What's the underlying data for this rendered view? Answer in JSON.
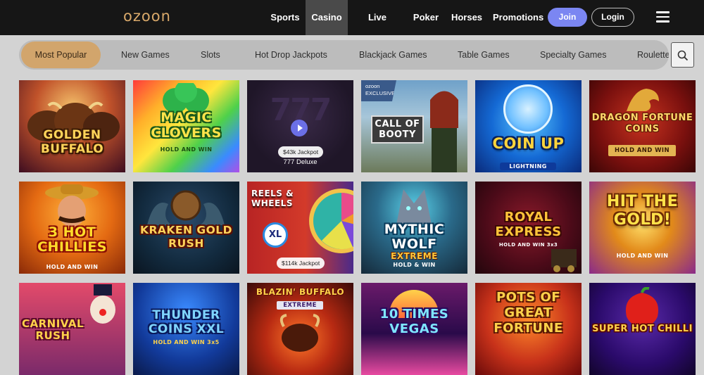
{
  "header": {
    "logo": "ozoon",
    "nav": [
      {
        "label": "Sports",
        "active": false
      },
      {
        "label": "Casino",
        "active": true
      },
      {
        "label": "Live Casino",
        "active": false
      },
      {
        "label": "Poker",
        "active": false
      },
      {
        "label": "Horses",
        "active": false
      },
      {
        "label": "Promotions",
        "active": false
      }
    ],
    "join_label": "Join",
    "login_label": "Login",
    "menu_icon": "hamburger-icon"
  },
  "categories": {
    "items": [
      {
        "label": "Most Popular",
        "active": true
      },
      {
        "label": "New Games",
        "active": false
      },
      {
        "label": "Slots",
        "active": false
      },
      {
        "label": "Hot Drop Jackpots",
        "active": false
      },
      {
        "label": "Blackjack Games",
        "active": false
      },
      {
        "label": "Table Games",
        "active": false
      },
      {
        "label": "Specialty Games",
        "active": false
      },
      {
        "label": "Roulette",
        "active": false
      }
    ],
    "search_icon": "search-icon"
  },
  "games": [
    {
      "title": "GOLDEN BUFFALO",
      "subtitle": ""
    },
    {
      "title": "MAGIC CLOVERS",
      "subtitle": "HOLD AND WIN"
    },
    {
      "title": "777",
      "jackpot": "$43k Jackpot",
      "caption": "777 Deluxe"
    },
    {
      "title": "CALL OF BOOTY",
      "badge": "ozoon EXCLUSIVE"
    },
    {
      "title": "COIN UP",
      "subtitle": "LIGHTNING"
    },
    {
      "title": "DRAGON FORTUNE COINS",
      "subtitle": "HOLD AND WIN"
    },
    {
      "title": "3 HOT CHILLIES",
      "subtitle": "HOLD AND WIN"
    },
    {
      "title": "KRAKEN GOLD RUSH",
      "subtitle": ""
    },
    {
      "title": "REELS & WHEELS",
      "jackpot": "$114k Jackpot",
      "badge": "XL"
    },
    {
      "title": "MYTHIC WOLF",
      "subtitle": "EXTREME",
      "subtitle2": "HOLD & WIN"
    },
    {
      "title": "ROYAL EXPRESS",
      "subtitle": "HOLD AND WIN 3x3"
    },
    {
      "title": "HIT THE GOLD!",
      "subtitle": "HOLD AND WIN"
    },
    {
      "title": "CARNIVAL RUSH",
      "subtitle": ""
    },
    {
      "title": "THUNDER COINS XXL",
      "subtitle": "HOLD AND WIN 3x5"
    },
    {
      "title": "BLAZIN' BUFFALO",
      "subtitle": "EXTREME"
    },
    {
      "title": "10 TIMES VEGAS",
      "subtitle": ""
    },
    {
      "title": "POTS OF GREAT FORTUNE",
      "subtitle": ""
    },
    {
      "title": "SUPER HOT CHILLI",
      "subtitle": ""
    }
  ],
  "colors": {
    "topbar": "#161616",
    "accent_gold": "#d2a56c",
    "join_blue": "#7b86f2",
    "page_bg": "#d3d3d3"
  }
}
